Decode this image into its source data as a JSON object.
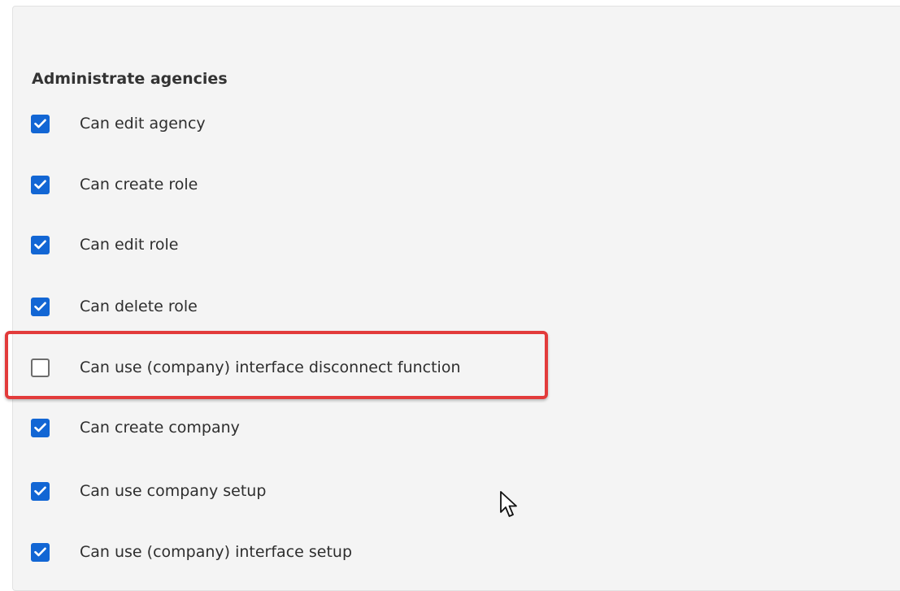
{
  "section": {
    "title": "Administrate agencies"
  },
  "permissions": [
    {
      "label": "Can edit agency",
      "checked": true
    },
    {
      "label": "Can create role",
      "checked": true
    },
    {
      "label": "Can edit role",
      "checked": true
    },
    {
      "label": "Can delete role",
      "checked": true
    },
    {
      "label": "Can use (company) interface disconnect function",
      "checked": false
    },
    {
      "label": "Can create company",
      "checked": true
    },
    {
      "label": "Can use company setup",
      "checked": true
    },
    {
      "label": "Can use (company) interface setup",
      "checked": true
    }
  ],
  "colors": {
    "checkbox_checked": "#1266d4",
    "highlight_border": "#e23b3b",
    "panel_background": "#f4f4f4"
  },
  "icons": {
    "check": "check-icon",
    "cursor": "mouse-cursor-icon"
  }
}
